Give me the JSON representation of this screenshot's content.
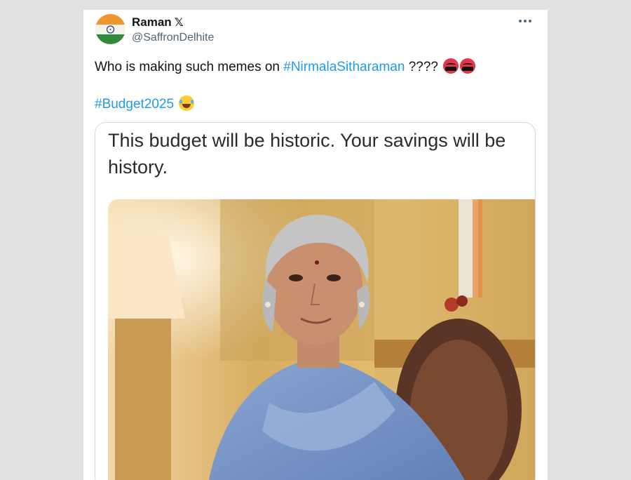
{
  "tweet": {
    "author": {
      "display_name": "Raman",
      "badge": "𝕏",
      "handle": "@SaffronDelhite",
      "avatar_icon": "india-flag-avatar"
    },
    "menu_icon": "more-options-icon",
    "text_prefix": "Who is making such memes on ",
    "hashtag_1": "#NirmalaSitharaman",
    "text_suffix": " ???? ",
    "emojis_line1": [
      "face-with-symbols-on-mouth",
      "face-with-symbols-on-mouth"
    ],
    "hashtag_2": "#Budget2025",
    "emoji_line2": "face-with-tears-of-joy",
    "colors": {
      "link": "#1d9bf0",
      "text": "#0f1419",
      "secondary": "#536471",
      "border": "#cfd9de"
    }
  },
  "media": {
    "caption": "This budget will be historic. Your savings will be history.",
    "photo_icon": "portrait-photo"
  }
}
